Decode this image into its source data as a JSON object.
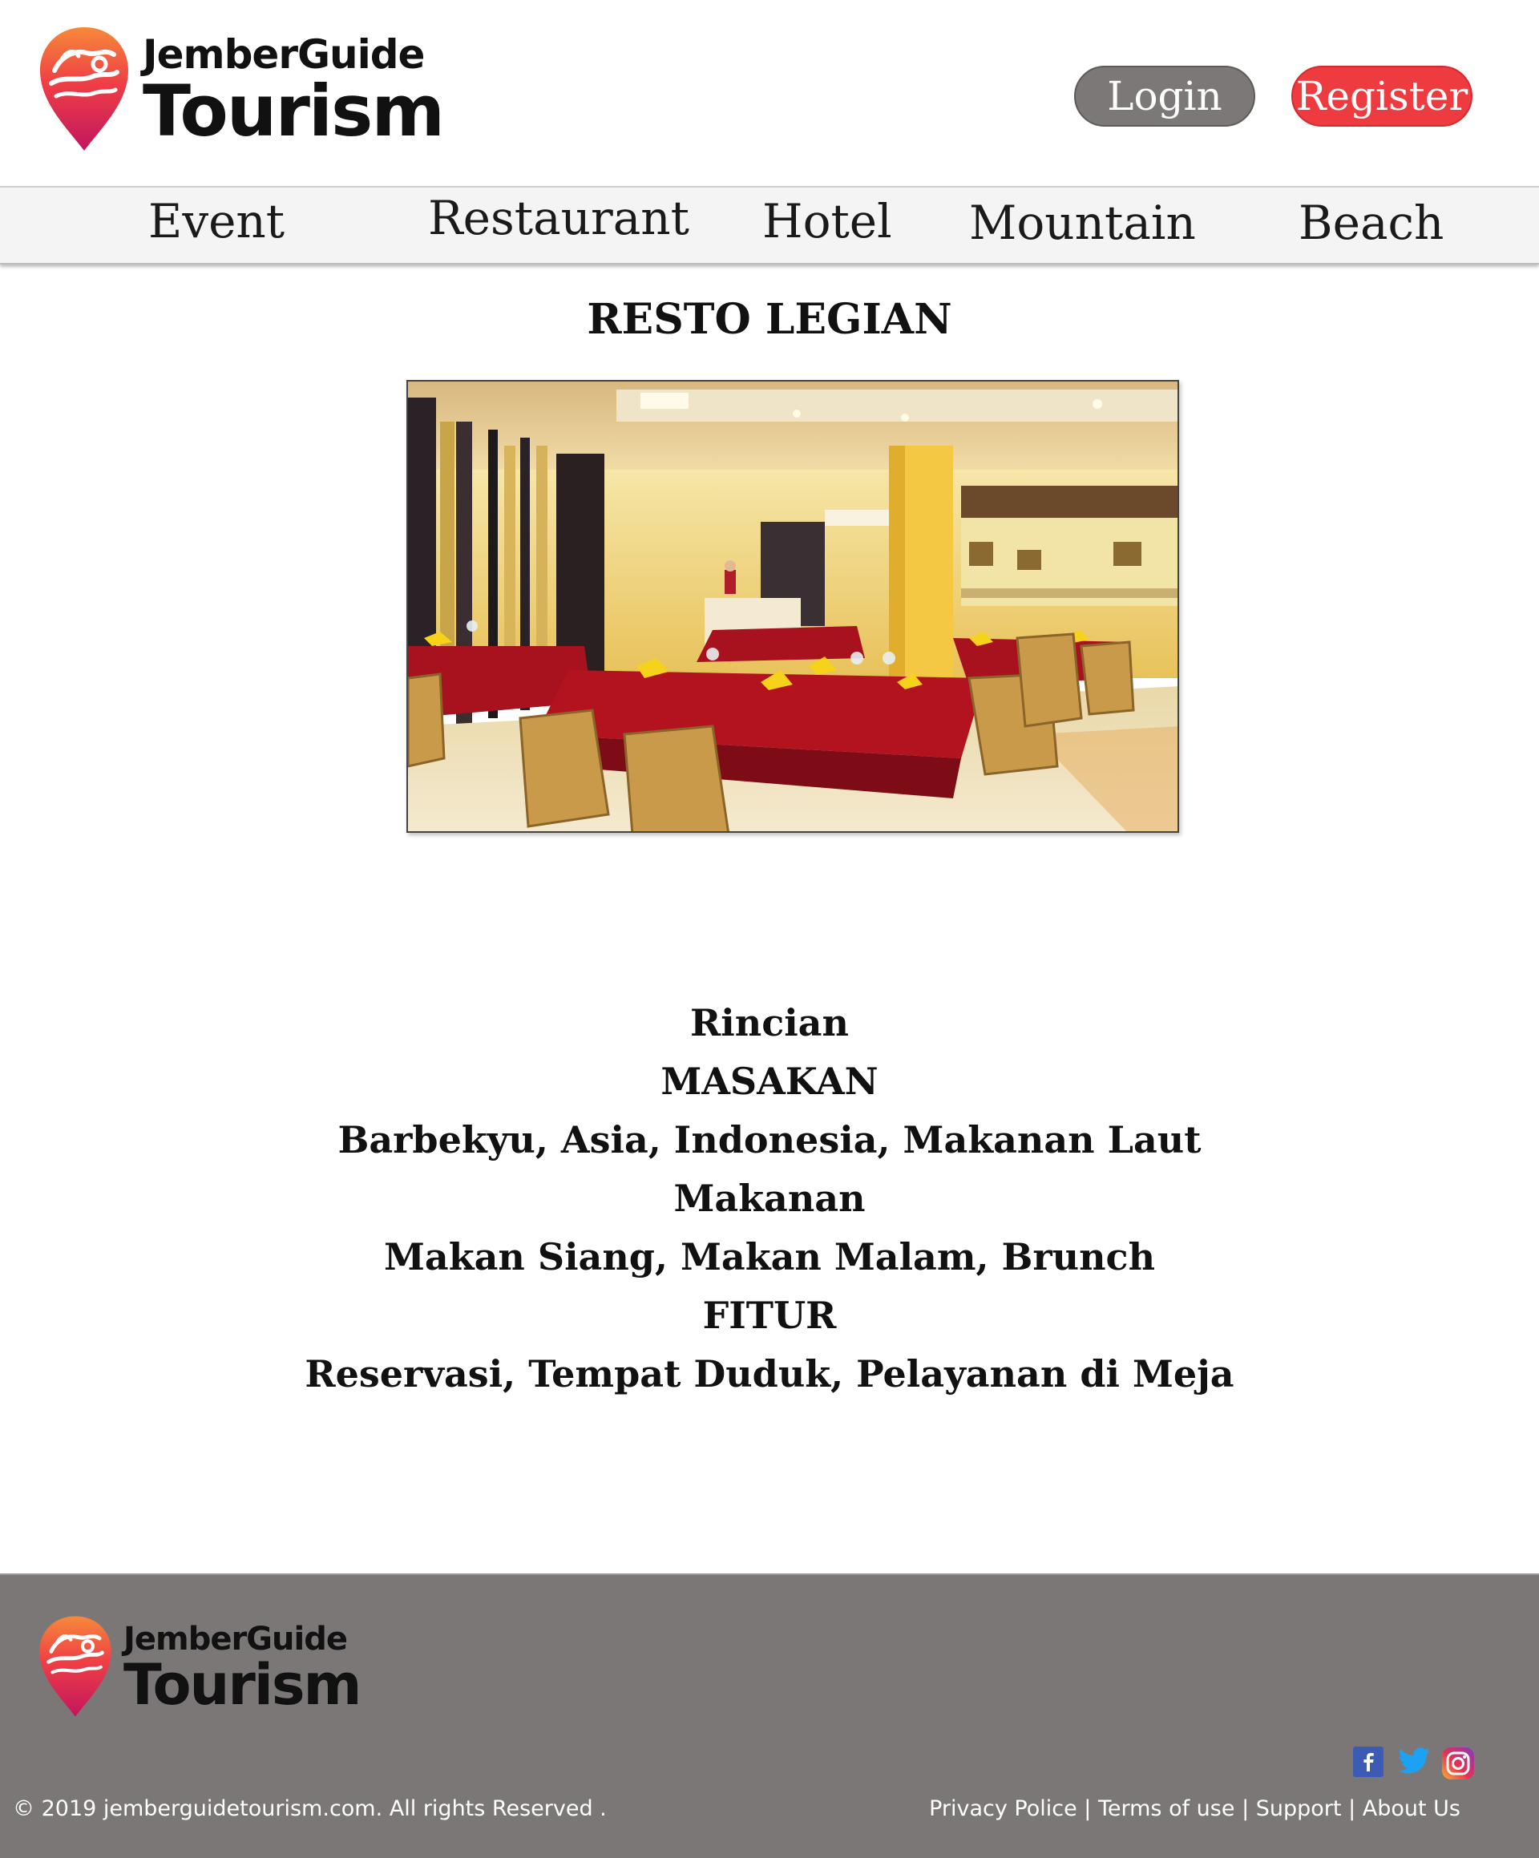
{
  "brand": {
    "line1": "JemberGuide",
    "line2": "Tourism",
    "colors": {
      "pin_top": "#f26a3a",
      "pin_bottom": "#c8185a"
    }
  },
  "header": {
    "login_label": "Login",
    "register_label": "Register"
  },
  "nav": {
    "items": [
      {
        "label": "Event"
      },
      {
        "label": "Restaurant"
      },
      {
        "label": "Hotel"
      },
      {
        "label": "Mountain"
      },
      {
        "label": "Beach"
      }
    ]
  },
  "page": {
    "title": "RESTO LEGIAN"
  },
  "details": {
    "lines": [
      "Rincian",
      "MASAKAN",
      "Barbekyu, Asia, Indonesia, Makanan Laut",
      "Makanan",
      "Makan Siang, Makan Malam, Brunch",
      "FITUR",
      "Reservasi, Tempat Duduk, Pelayanan di Meja"
    ]
  },
  "footer": {
    "copyright": "© 2019 jemberguidetourism.com. All rights Reserved .",
    "links": [
      "Privacy Police",
      "Terms of use",
      "Support",
      "About Us"
    ],
    "separator": " | ",
    "social_icons": [
      "facebook-icon",
      "twitter-icon",
      "instagram-icon"
    ]
  },
  "colors": {
    "accent_red": "#ee3b3f",
    "login_gray": "#7d7878",
    "footer_bg": "#7b7777",
    "nav_bg": "#f4f4f4"
  }
}
